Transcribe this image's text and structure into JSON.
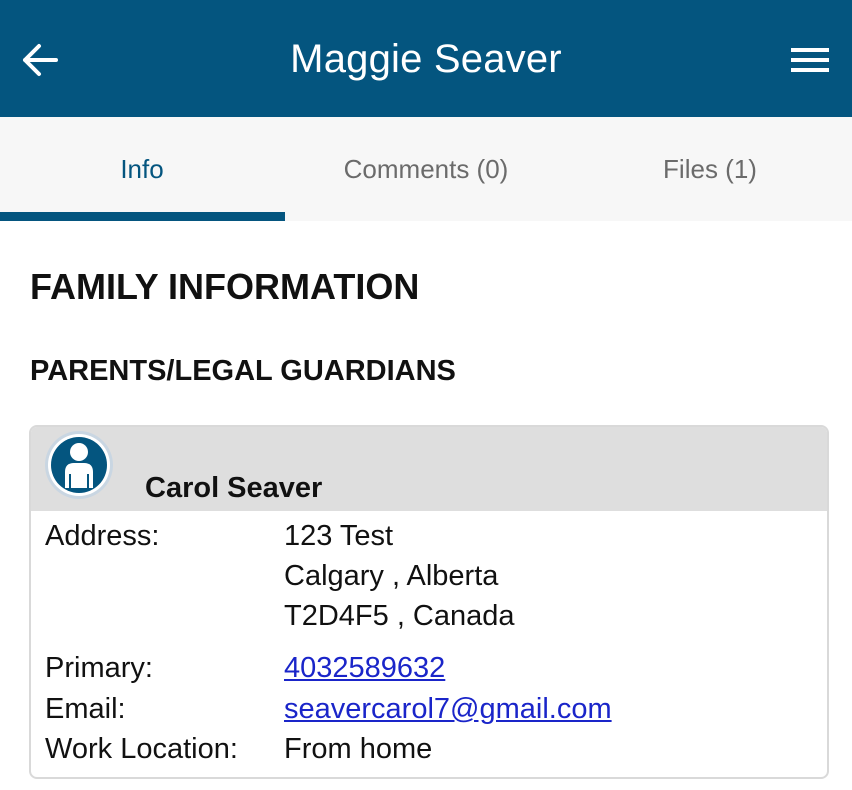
{
  "header": {
    "title": "Maggie Seaver",
    "back_icon": "arrow-left-icon",
    "menu_icon": "hamburger-menu-icon",
    "bg_color": "#04557f"
  },
  "tabs": [
    {
      "label": "Info",
      "active": true
    },
    {
      "label": "Comments (0)",
      "active": false
    },
    {
      "label": "Files (1)",
      "active": false
    }
  ],
  "section_title": "FAMILY INFORMATION",
  "subsection_title": "PARENTS/LEGAL GUARDIANS",
  "guardian": {
    "avatar_icon": "person-avatar-icon",
    "name": "Carol Seaver",
    "fields": {
      "address_label": "Address:",
      "address_line1": "123 Test",
      "address_line2": "Calgary , Alberta",
      "address_line3": "T2D4F5 , Canada",
      "primary_label": "Primary:",
      "primary_value": "4032589632",
      "email_label": "Email:",
      "email_value": "seavercarol7@gmail.com",
      "work_label": "Work Location:",
      "work_value": "From home"
    }
  },
  "colors": {
    "accent": "#04557f",
    "link": "#1a25c9",
    "tab_inactive": "#6b6b6b"
  }
}
